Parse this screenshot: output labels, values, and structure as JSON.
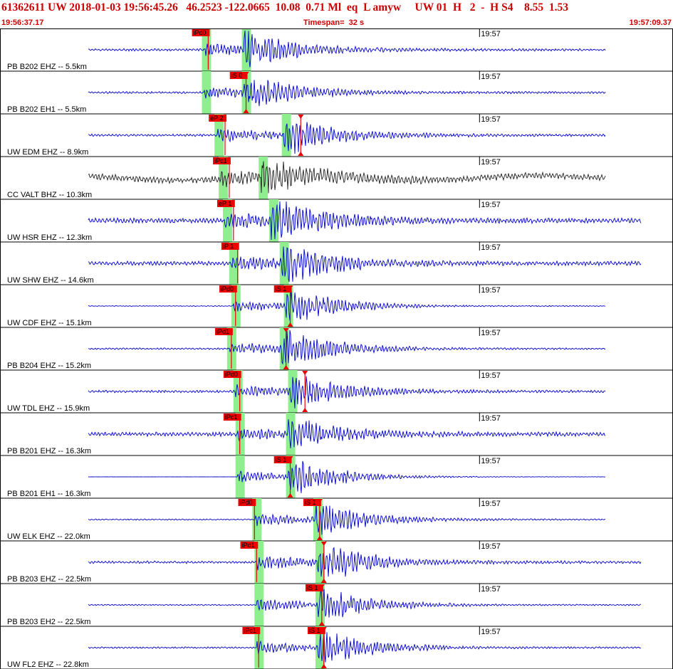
{
  "header": {
    "event_line": "61362611 UW 2018-01-03 19:56:45.26   46.2523 -122.0665  10.08  0.71 Ml  eq  L amyw     UW 01  H   2  -  H S4    8.55  1.53",
    "start_time": "19:56:37.17",
    "timespan": "Timespan=  32 s",
    "end_time": "19:57:09.37"
  },
  "colors": {
    "trace": "#0000cc",
    "trace_alt": "#222222",
    "pick": "#ee0000",
    "window": "#8fef8f",
    "border": "#000000"
  },
  "chart_data": {
    "type": "line",
    "title": "61362611 UW 2018-01-03 19:56:45.26",
    "x_range_s": [
      0,
      32
    ],
    "time_marker": {
      "label": "19:57",
      "t": 22.8
    },
    "traces": [
      {
        "label": "PB B202 EHZ -- 5.5km",
        "picks": [
          {
            "label": "iPd0",
            "t": 9.9
          }
        ],
        "p_start": 9.7,
        "s_start": 11.6,
        "amp": 0.8,
        "noise": 0.06
      },
      {
        "label": "PB B202 EH1 -- 5.5km",
        "picks": [
          {
            "label": "iS 0",
            "t": 11.7,
            "tri": true
          }
        ],
        "p_start": 9.7,
        "s_start": 11.6,
        "amp": 0.85,
        "noise": 0.05
      },
      {
        "label": "UW EDM EHZ -- 8.9km",
        "picks": [
          {
            "label": "eP 2",
            "t": 10.7
          },
          {
            "label": "",
            "t": 14.3,
            "tri": true
          }
        ],
        "p_start": 10.3,
        "s_start": 13.5,
        "amp": 0.9,
        "noise": 0.06
      },
      {
        "label": "CC VALT BHZ -- 10.3km",
        "picks": [
          {
            "label": "iPc1",
            "t": 10.9
          }
        ],
        "p_start": 10.5,
        "s_start": 12.4,
        "amp": 0.75,
        "noise": 0.15,
        "alt": true
      },
      {
        "label": "UW HSR EHZ -- 12.3km",
        "picks": [
          {
            "label": "eP 1",
            "t": 11.1
          }
        ],
        "p_start": 10.7,
        "s_start": 12.9,
        "amp": 0.95,
        "noise": 0.12
      },
      {
        "label": "UW SHW EHZ -- 14.6km",
        "picks": [
          {
            "label": "iP 1",
            "t": 11.3
          }
        ],
        "p_start": 11.0,
        "s_start": 13.4,
        "amp": 0.9,
        "noise": 0.1
      },
      {
        "label": "UW CDF EHZ -- 15.1km",
        "picks": [
          {
            "label": "iPd0",
            "t": 11.2
          },
          {
            "label": "iS 1",
            "t": 13.8,
            "tri": true
          }
        ],
        "p_start": 11.1,
        "s_start": 13.6,
        "amp": 0.85,
        "noise": 0.02
      },
      {
        "label": "PB B204 EHZ -- 15.2km",
        "picks": [
          {
            "label": "iPd1",
            "t": 11.0
          },
          {
            "label": "",
            "t": 13.6,
            "tri": true
          }
        ],
        "p_start": 10.9,
        "s_start": 13.4,
        "amp": 0.9,
        "noise": 0.04
      },
      {
        "label": "UW TDL EHZ -- 15.9km",
        "picks": [
          {
            "label": "iPd0",
            "t": 11.4
          },
          {
            "label": "",
            "t": 14.5,
            "tri": true
          }
        ],
        "p_start": 11.2,
        "s_start": 13.8,
        "amp": 0.8,
        "noise": 0.06
      },
      {
        "label": "PB B201 EHZ -- 16.3km",
        "picks": [
          {
            "label": "iPc1",
            "t": 11.4
          }
        ],
        "p_start": 11.3,
        "s_start": 13.7,
        "amp": 0.7,
        "noise": 0.1
      },
      {
        "label": "PB B201 EH1 -- 16.3km",
        "picks": [
          {
            "label": "iS 1",
            "t": 13.8,
            "tri": true
          }
        ],
        "p_start": 11.3,
        "s_start": 13.7,
        "amp": 0.9,
        "noise": 0.005
      },
      {
        "label": "UW ELK EHZ -- 22.0km",
        "picks": [
          {
            "label": "iPd0",
            "t": 12.1
          },
          {
            "label": "iS 1",
            "t": 15.2,
            "tri": true
          }
        ],
        "p_start": 12.1,
        "s_start": 15.0,
        "amp": 0.8,
        "noise": 0.03
      },
      {
        "label": "PB B203 EHZ -- 22.5km",
        "picks": [
          {
            "label": "iPd1",
            "t": 12.2
          },
          {
            "label": "",
            "t": 15.4,
            "tri": true
          }
        ],
        "p_start": 12.2,
        "s_start": 15.1,
        "amp": 0.95,
        "noise": 0.06
      },
      {
        "label": "PB B203 EH2 -- 22.5km",
        "picks": [
          {
            "label": "iS 1",
            "t": 15.3,
            "tri": true
          }
        ],
        "p_start": 12.2,
        "s_start": 15.1,
        "amp": 0.85,
        "noise": 0.03
      },
      {
        "label": "UW FL2 EHZ -- 22.8km",
        "picks": [
          {
            "label": "iPc1",
            "t": 12.3
          },
          {
            "label": "iS 1",
            "t": 15.4,
            "tri": true
          }
        ],
        "p_start": 12.2,
        "s_start": 15.1,
        "amp": 0.85,
        "noise": 0.04
      }
    ]
  }
}
